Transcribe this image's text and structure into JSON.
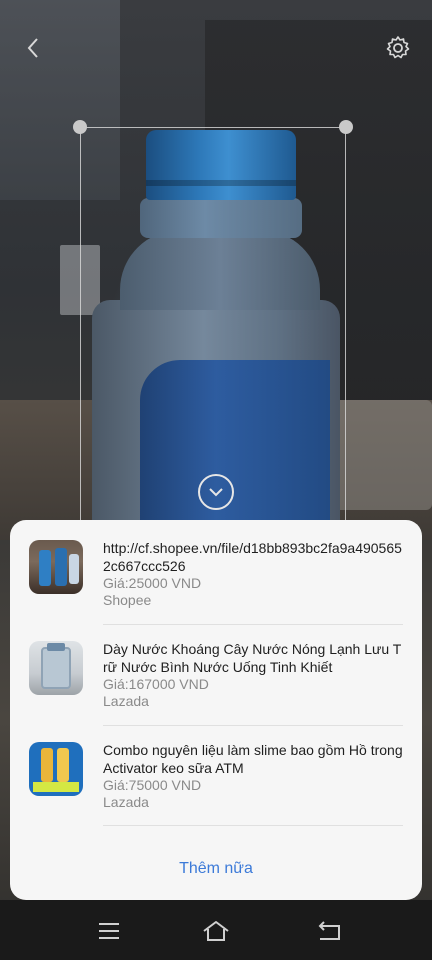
{
  "toolbar": {
    "back_icon": "chevron-left-icon",
    "settings_icon": "gear-icon"
  },
  "viewfinder": {
    "expand_icon": "chevron-down-icon"
  },
  "results": [
    {
      "title": "http://cf.shopee.vn/file/d18bb893bc2fa9a4905652c667ccc526",
      "price": "Giá:25000 VND",
      "store": "Shopee"
    },
    {
      "title": "Dày Nước Khoáng Cây Nước Nóng Lạnh Lưu Trữ Nước Bình Nước Uống Tinh Khiết",
      "price": "Giá:167000 VND",
      "store": "Lazada"
    },
    {
      "title": "Combo nguyên liệu làm slime bao gồm Hồ trong Activator keo sữa ATM",
      "price": "Giá:75000 VND",
      "store": "Lazada"
    }
  ],
  "more_label": "Thêm nữa",
  "navbar": {
    "menu_icon": "menu-icon",
    "home_icon": "home-icon",
    "back_icon": "back-icon"
  },
  "colors": {
    "accent": "#3c7ad8",
    "sheet_bg": "#f6f6f6",
    "cap_blue": "#2d78b8"
  }
}
